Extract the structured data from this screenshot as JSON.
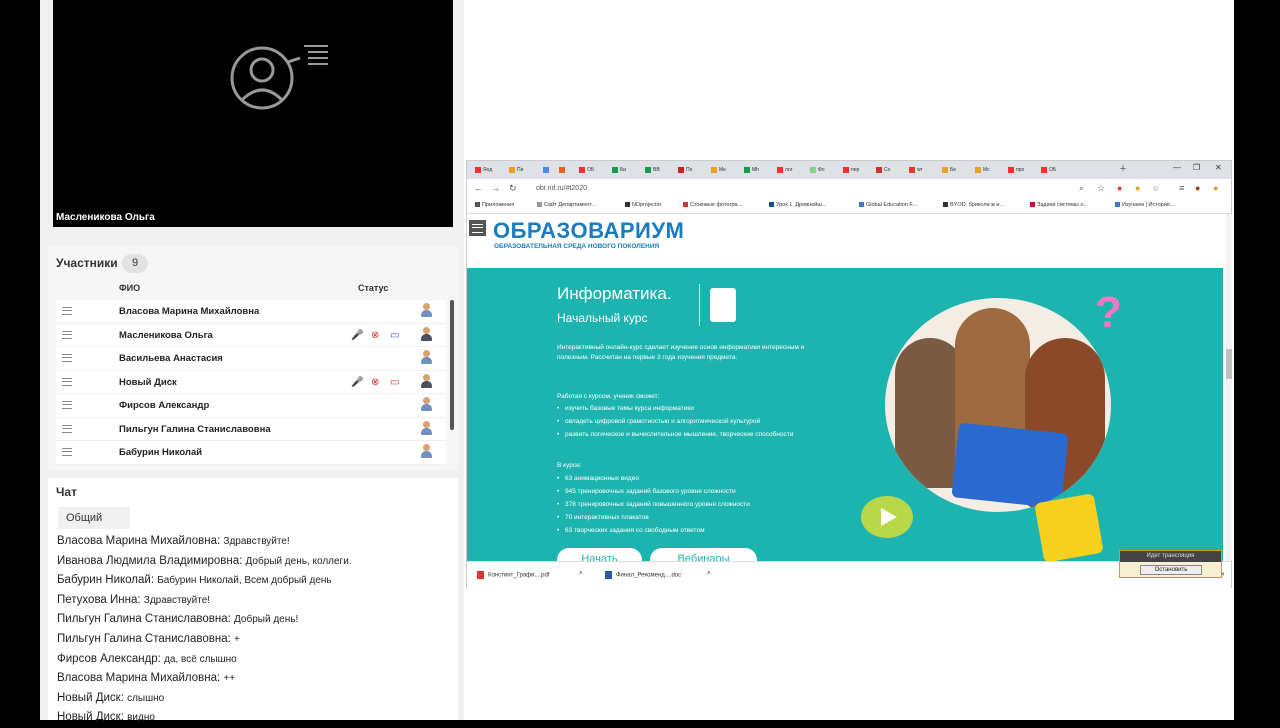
{
  "video": {
    "presenter_name": "Масленикова Ольга"
  },
  "participants": {
    "title": "Участники",
    "count": "9",
    "col_name": "ФИО",
    "col_status": "Статус",
    "rows": [
      {
        "name": "Власова Марина  Михайловна"
      },
      {
        "name": "Масленикова Ольга"
      },
      {
        "name": "Васильева Анастасия"
      },
      {
        "name": "Новый Диск"
      },
      {
        "name": "Фирсов Александр"
      },
      {
        "name": "Пильгун Галина  Станиславовна"
      },
      {
        "name": "Бабурин Николай"
      }
    ]
  },
  "chat": {
    "title": "Чат",
    "tab": "Общий",
    "messages": [
      {
        "author": "Власова Марина  Михайловна:",
        "text": "Здравствуйте!"
      },
      {
        "author": "Иванова Людмила  Владимировна:",
        "text": "Добрый день, коллеги."
      },
      {
        "author": "Бабурин Николай:",
        "text": "Бабурин Николай, Всем добрый день"
      },
      {
        "author": "Петухова Инна:",
        "text": "Здравствуйте!"
      },
      {
        "author": "Пильгун Галина  Станиславовна:",
        "text": "Добрый день!"
      },
      {
        "author": "Пильгун Галина  Станиславовна:",
        "text": "+"
      },
      {
        "author": "Фирсов Александр:",
        "text": "да, всё слышно"
      },
      {
        "author": "Власова Марина  Михайловна:",
        "text": "++"
      },
      {
        "author": "Новый Диск:",
        "text": "слышно"
      },
      {
        "author": "Новый Диск:",
        "text": "видно"
      }
    ]
  },
  "browser": {
    "tabs": [
      "Янд",
      "Пи",
      "",
      "",
      "ОБ",
      "Би",
      "ВВ",
      "По",
      "Me",
      "Мh",
      "лог",
      "Фо",
      "пер",
      "Co",
      "wr",
      "Бе",
      "Mc",
      "про",
      "ОБ"
    ],
    "url": "obr.nd.ru/#t2020",
    "bookmarks": [
      "Приложения",
      "Сайт Департамент...",
      "NDprojector",
      "Стоковые фотогра...",
      "Урок 1. Древнейш...",
      "Global Education F...",
      "BYOD, брикола ж и...",
      "Задачи системы о...",
      "Изучаем | История..."
    ],
    "downloads": [
      "Констинт_Графи....pdf",
      "Финал_Рекоменд....doc"
    ],
    "share": {
      "title": "Идет трансляция",
      "button": "Остановить"
    }
  },
  "site": {
    "logo": "ОБРАЗОВАРИУМ",
    "logo_sub": "ОБРАЗОВАТЕЛЬНАЯ СРЕДА НОВОГО ПОКОЛЕНИЯ",
    "course_title": "Информатика.",
    "course_sub": "Начальный курс",
    "description": "Интерактивный онлайн-курс сделает изучение основ информатики интересным и полезным. Рассчитан на первые 3 года изучения предмета.",
    "skills_title": "Работая с курсом, ученик сможет:",
    "skills": [
      "изучить базовые темы курса информатики",
      "овладеть цифровой грамотностью и алгоритмической культурой",
      "развить логическое и вычислительное мышление, творческие способности"
    ],
    "includes_title": "В курсе:",
    "includes": [
      "63 анимационных видео",
      "945 тренировочных заданий базового уровня сложности",
      "378 тренировочных заданий повышенного уровня сложности",
      "70 интерактивных плакатов",
      "63 творческих задания со свободным ответом"
    ],
    "btn_start": "Начать",
    "btn_webinars": "Вебинары"
  }
}
